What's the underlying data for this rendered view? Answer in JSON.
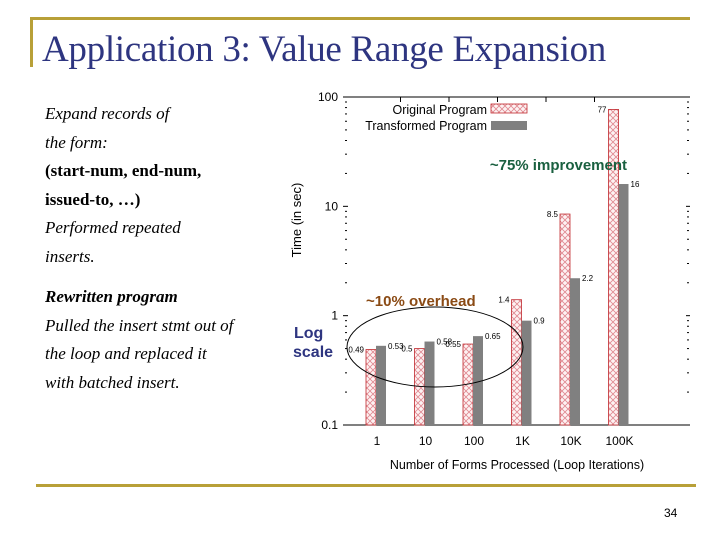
{
  "slide": {
    "title": "Application 3: Value Range Expansion",
    "page_number": "34",
    "accent_color": "#b8a038",
    "title_color": "#2e3580"
  },
  "body": {
    "lines": [
      {
        "text": "Expand records of",
        "style": "italic"
      },
      {
        "text": "the form:",
        "style": "italic"
      },
      {
        "text": "(start-num, end-num,",
        "style": "bold"
      },
      {
        "text": "issued-to, …)",
        "style": "bold"
      },
      {
        "text": "Performed repeated",
        "style": "italic"
      },
      {
        "text": "inserts.",
        "style": "italic"
      }
    ],
    "lines2": [
      {
        "text": "Rewritten program",
        "style": "bold-italic"
      },
      {
        "text": "Pulled the insert stmt out of",
        "style": "italic"
      },
      {
        "text": "the loop and replaced it",
        "style": "italic"
      },
      {
        "text": "with batched insert.",
        "style": "italic"
      }
    ]
  },
  "chart_data": {
    "type": "bar",
    "title": "",
    "xlabel": "Number of Forms Processed (Loop Iterations)",
    "ylabel": "Time (in sec)",
    "yscale": "log",
    "ylim": [
      0.1,
      100
    ],
    "yticks": [
      "0.1",
      "1",
      "10",
      "100"
    ],
    "categories": [
      "1",
      "10",
      "100",
      "1K",
      "10K",
      "100K"
    ],
    "series": [
      {
        "name": "Original Program",
        "values": [
          0.49,
          0.5,
          0.55,
          1.4,
          8.5,
          77
        ],
        "labels": [
          "0.49",
          "0.5",
          "0.55",
          "1.4",
          "8.5",
          "77"
        ],
        "color": "#c0282d",
        "pattern": "crosshatch"
      },
      {
        "name": "Transformed Program",
        "values": [
          0.53,
          0.58,
          0.65,
          0.9,
          2.2,
          16
        ],
        "labels": [
          "0.53",
          "0.58",
          "0.65",
          "0.9",
          "2.2",
          "16"
        ],
        "color": "#808080",
        "pattern": "solid"
      }
    ],
    "legend": "top-right",
    "annotations": {
      "improvement": {
        "text": "~75% improvement",
        "color": "#1a6040"
      },
      "overhead": {
        "text": "~10% overhead",
        "color": "#8a4a14"
      },
      "log_scale": {
        "text_line1": "Log",
        "text_line2": "scale",
        "color": "#2e3580"
      }
    }
  }
}
